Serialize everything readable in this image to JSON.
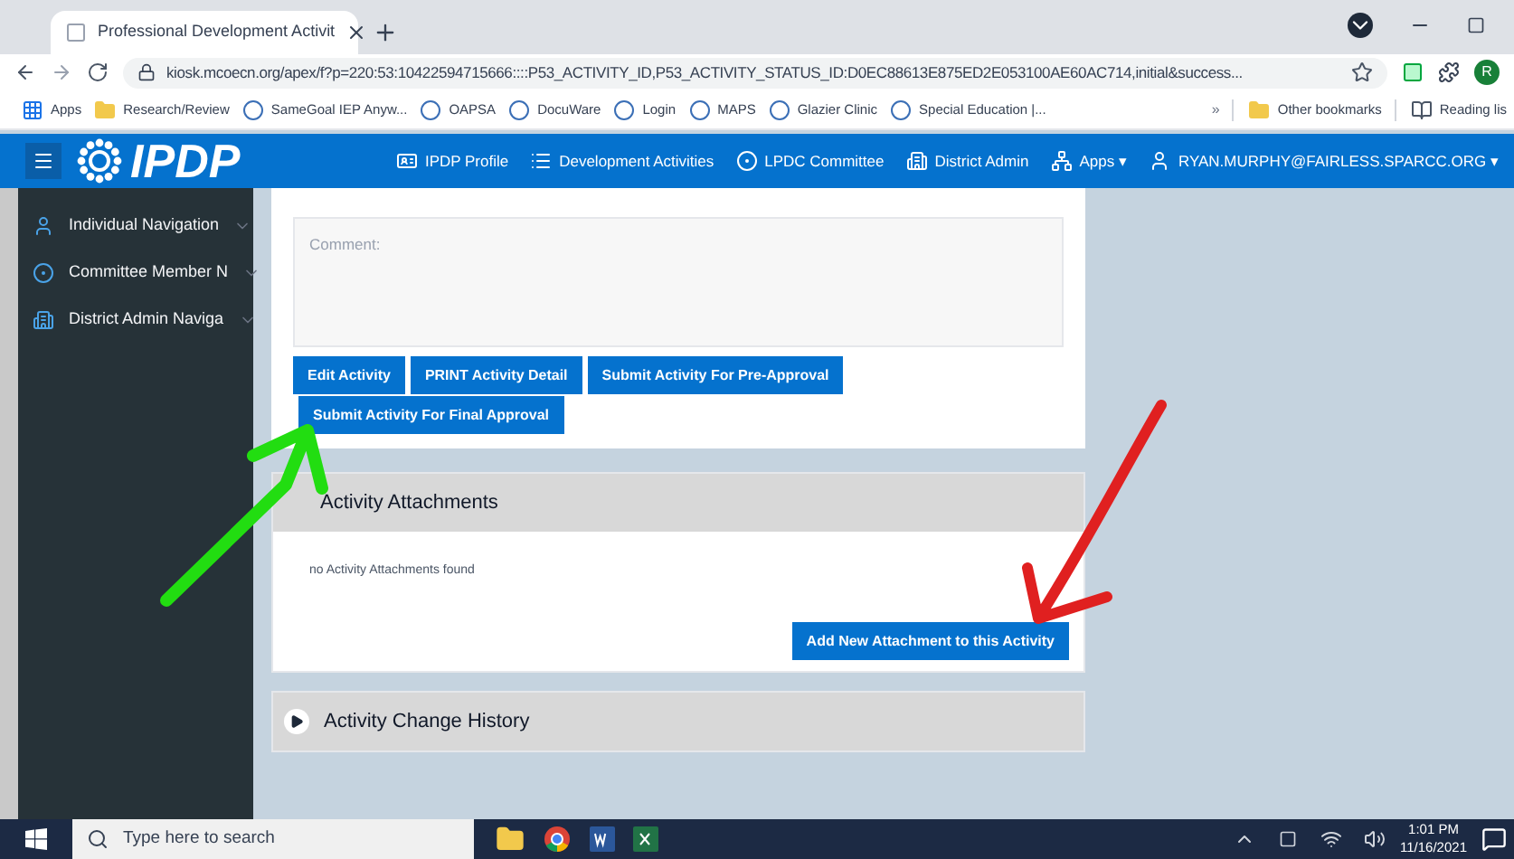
{
  "browser": {
    "tab": {
      "title": "Professional Development Activit"
    },
    "url": "kiosk.mcoecn.org/apex/f?p=220:53:10422594715666::::P53_ACTIVITY_ID,P53_ACTIVITY_STATUS_ID:D0EC88613E875ED2E053100AE60AC714,initial&success...",
    "profile": "R",
    "bookmarks": [
      {
        "label": "Apps",
        "kind": "apps"
      },
      {
        "label": "Research/Review",
        "kind": "folder"
      },
      {
        "label": "SameGoal IEP Anyw...",
        "kind": "site"
      },
      {
        "label": "OAPSA",
        "kind": "site"
      },
      {
        "label": "DocuWare",
        "kind": "site"
      },
      {
        "label": "Login",
        "kind": "site"
      },
      {
        "label": "MAPS",
        "kind": "site"
      },
      {
        "label": "Glazier Clinic",
        "kind": "site"
      },
      {
        "label": "Special Education |...",
        "kind": "site"
      }
    ],
    "more": "»",
    "other_bookmarks": "Other bookmarks",
    "reading_list": "Reading lis"
  },
  "app": {
    "logo": "IPDP",
    "nav": [
      {
        "label": "IPDP Profile",
        "kind": "profile"
      },
      {
        "label": "Development Activities",
        "kind": "list"
      },
      {
        "label": "LPDC Committee",
        "kind": "committee"
      },
      {
        "label": "District Admin",
        "kind": "building"
      },
      {
        "label": "Apps ▾",
        "kind": "apps"
      },
      {
        "label": "RYAN.MURPHY@FAIRLESS.SPARCC.ORG ▾",
        "kind": "user"
      }
    ]
  },
  "sidebar": {
    "items": [
      {
        "label": "Individual Navigation",
        "kind": "user"
      },
      {
        "label": "Committee Member N",
        "kind": "committee"
      },
      {
        "label": "District Admin Naviga",
        "kind": "building"
      }
    ]
  },
  "activity": {
    "comment": {
      "placeholder": "Comment:"
    },
    "buttons": [
      "Edit Activity",
      "PRINT Activity Detail",
      "Submit Activity For Pre-Approval",
      "Submit Activity For Final Approval"
    ]
  },
  "attachments": {
    "title": "Activity Attachments",
    "empty": "no Activity Attachments found",
    "add_button": "Add New Attachment to this Activity"
  },
  "history": {
    "title": "Activity Change History",
    "expanded": false
  },
  "taskbar": {
    "search": {
      "placeholder": "Type here to search"
    },
    "time": "1:01 PM",
    "date": "11/16/2021"
  }
}
